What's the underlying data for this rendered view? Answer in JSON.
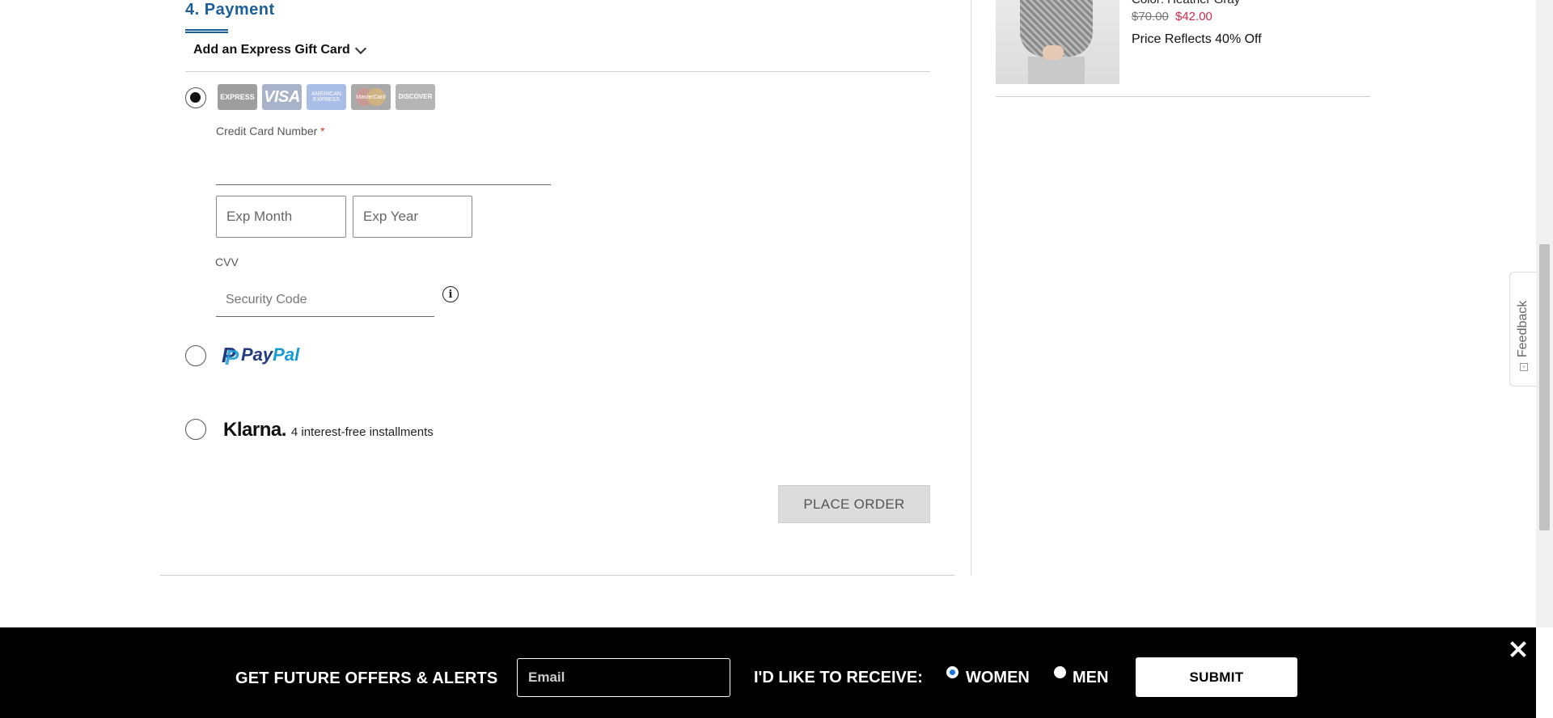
{
  "payment": {
    "title": "4. Payment",
    "gift_card_toggle": "Add an Express Gift Card",
    "card_logos": {
      "express": "EXPRESS",
      "visa": "VISA",
      "amex": "AMERICAN EXPRESS",
      "mastercard": "MasterCard",
      "discover": "DISCOVER"
    },
    "credit_card_label": "Credit Card Number",
    "required_mark": "*",
    "credit_card_value": "",
    "exp_month_placeholder": "Exp Month",
    "exp_year_placeholder": "Exp Year",
    "cvv_label": "CVV",
    "cvv_placeholder": "Security Code",
    "info_icon": "i",
    "paypal": {
      "pay": "Pay",
      "pal": "Pal",
      "p": "P"
    },
    "klarna": {
      "logo": "Klarna.",
      "subtitle": "4 interest-free installments"
    },
    "selected_method": "credit-card",
    "place_order_label": "PLACE ORDER"
  },
  "summary": {
    "color_text": "Color: Heather Gray",
    "price_original": "$70.00",
    "price_sale": "$42.00",
    "price_note": "Price Reflects 40% Off"
  },
  "feedback": {
    "label": "Feedback"
  },
  "banner": {
    "title": "GET FUTURE OFFERS & ALERTS",
    "email_placeholder": "Email",
    "receive_label": "I'D LIKE TO RECEIVE:",
    "options": [
      {
        "label": "WOMEN",
        "selected": true
      },
      {
        "label": "MEN",
        "selected": false
      }
    ],
    "submit_label": "SUBMIT"
  },
  "colors": {
    "accent_blue": "#1a5f9c",
    "sale_red": "#d0264a",
    "paypal_dark": "#253b80",
    "paypal_light": "#179bd7"
  }
}
